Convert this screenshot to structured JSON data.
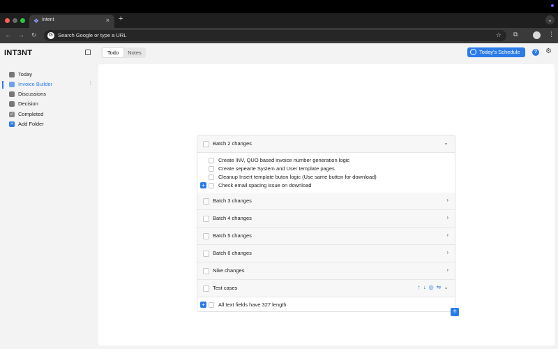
{
  "browser": {
    "tab_title": "Intent",
    "tab_close": "×",
    "new_tab": "+",
    "omnibox_placeholder": "Search Google or type a URL",
    "g_letter": "G"
  },
  "app": {
    "logo": "INT3NT",
    "view_tabs": [
      {
        "label": "Todo",
        "selected": true
      },
      {
        "label": "Notes",
        "selected": false
      }
    ],
    "schedule_button": "Today's Schedule",
    "help": "?",
    "accent_color": "#2b7be9"
  },
  "sidebar": {
    "items": [
      {
        "label": "Today",
        "icon": "calendar-icon"
      },
      {
        "label": "Invoice Builder",
        "icon": "folder-icon",
        "active": true
      },
      {
        "label": "Discussions",
        "icon": "folder-icon"
      },
      {
        "label": "Decision",
        "icon": "folder-icon"
      },
      {
        "label": "Completed",
        "icon": "check-icon"
      },
      {
        "label": "Add Folder",
        "icon": "plus-icon"
      }
    ]
  },
  "groups": [
    {
      "title": "Batch 2 changes",
      "expanded": true,
      "tasks": [
        "Create INV, QUO based invoice number generation logic",
        "Create sepearte System and User template pages",
        "Cleanup Insert template buton logic (Use same button for download)",
        "Check email spacing issue on download"
      ]
    },
    {
      "title": "Batch 3 changes",
      "expanded": false
    },
    {
      "title": "Batch 4 changes",
      "expanded": false
    },
    {
      "title": "Batch 5 changes",
      "expanded": false
    },
    {
      "title": "Batch 6 changes",
      "expanded": false
    },
    {
      "title": "Nike changes",
      "expanded": false
    },
    {
      "title": "Test cases",
      "expanded": true,
      "tasks": [
        "All text fields have 327 length"
      ]
    }
  ]
}
